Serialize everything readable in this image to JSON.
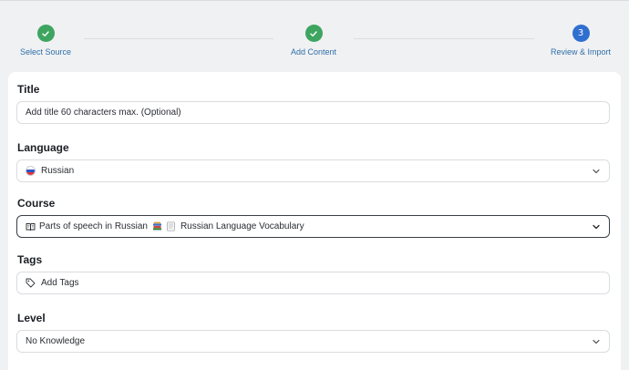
{
  "steps": [
    {
      "label": "Select Source",
      "state": "done",
      "icon": "check-icon"
    },
    {
      "label": "Add Content",
      "state": "done",
      "icon": "check-icon"
    },
    {
      "label": "Review & Import",
      "state": "current",
      "number": "3"
    }
  ],
  "colors": {
    "done": "#3ea561",
    "current": "#2f6fcf",
    "step_label": "#2f6fa8"
  },
  "form": {
    "title": {
      "label": "Title",
      "placeholder": "Add title 60 characters max. (Optional)"
    },
    "language": {
      "label": "Language",
      "value": "Russian",
      "icon": "russian-flag-icon"
    },
    "course": {
      "label": "Course",
      "value_part1": "Parts of speech in Russian",
      "value_part2": "Russian Language Vocabulary",
      "icons": [
        "book-icon",
        "books-emoji-icon",
        "notebook-emoji-icon"
      ]
    },
    "tags": {
      "label": "Tags",
      "placeholder": "Add Tags",
      "icon": "tag-icon"
    },
    "level": {
      "label": "Level",
      "value": "No Knowledge"
    }
  }
}
